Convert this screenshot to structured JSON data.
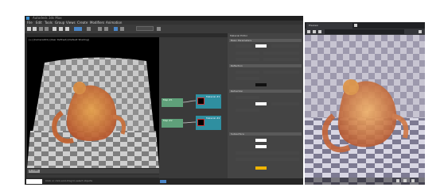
{
  "max": {
    "menu": [
      "File",
      "Edit",
      "Tools",
      "Group",
      "Views",
      "Create",
      "Modifiers",
      "Animation",
      "Graph Editors",
      "Rendering"
    ],
    "viewport_label": "[+] [Camera001] [User Defined] [Default Shading]",
    "frame_readout": "0 / 100",
    "node_editor": {
      "nodes": [
        {
          "label": "Map #1"
        },
        {
          "label": "Material #1"
        },
        {
          "label": "Map #2"
        },
        {
          "label": "Material #2"
        }
      ]
    },
    "material_panel": {
      "title": "Material Editor",
      "sections": [
        "Basic Parameters",
        "Reflection",
        "Refraction",
        "Subsurface"
      ]
    },
    "status": "Click or click-and-drag to select objects"
  },
  "browser": {
    "tab_title": "Preview",
    "address": "",
    "icons": [
      "back-icon",
      "forward-icon",
      "refresh-icon",
      "menu-icon"
    ]
  },
  "colors": {
    "max_bg": "#2b2b2b",
    "viewport_bg": "#000000",
    "node_bg": "#3a3a3a",
    "accent_blue": "#3a7fc4",
    "green_node": "#5fa07a",
    "teal_node": "#2f8fa0",
    "orange_swatch": "#f0b400"
  }
}
